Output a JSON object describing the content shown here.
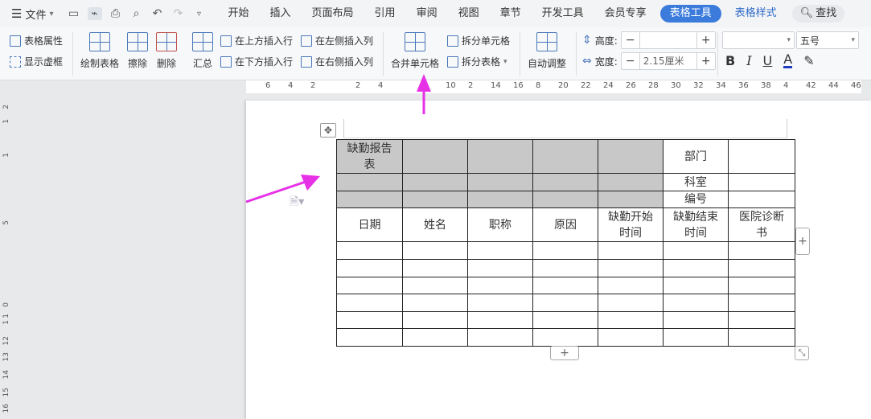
{
  "menubar": {
    "file_label": "文件",
    "tabs": [
      "开始",
      "插入",
      "页面布局",
      "引用",
      "审阅",
      "视图",
      "章节",
      "开发工具",
      "会员专享"
    ],
    "active_tab": "表格工具",
    "style_tab": "表格样式",
    "search_label": "查找"
  },
  "ribbon": {
    "table_props": "表格属性",
    "show_gridlines": "显示虚框",
    "draw_table": "绘制表格",
    "erase": "擦除",
    "delete": "删除",
    "summary": "汇总",
    "insert_row_above": "在上方插入行",
    "insert_row_below": "在下方插入行",
    "insert_col_left": "在左侧插入列",
    "insert_col_right": "在右侧插入列",
    "merge_cells": "合并单元格",
    "split_cells": "拆分单元格",
    "split_table": "拆分表格",
    "auto_fit": "自动调整",
    "height_label": "高度:",
    "height_value": "",
    "width_label": "宽度:",
    "width_value": "2.15厘米",
    "font_name": "",
    "font_size": "五号"
  },
  "ruler_h": [
    "6",
    "4",
    "2",
    "2",
    "4",
    "10",
    "2",
    "14",
    "16",
    "8",
    "20",
    "22",
    "24",
    "26",
    "28",
    "30",
    "32",
    "34",
    "36",
    "38",
    "4",
    "42",
    "44",
    "46"
  ],
  "ruler_v": [
    "2",
    "1",
    "1",
    "5",
    "1",
    "0",
    "1",
    "12",
    "13",
    "14",
    "15",
    "16"
  ],
  "table": {
    "title": "缺勤报告表",
    "dept": "部门",
    "office": "科室",
    "number": "编号",
    "headers": [
      "日期",
      "姓名",
      "职称",
      "原因",
      "缺勤开始时间",
      "缺勤结束时间",
      "医院诊断书"
    ]
  },
  "colors": {
    "accent": "#3a7bdc",
    "arrow": "#e631e6",
    "gray_cell": "#c8c8c8"
  }
}
